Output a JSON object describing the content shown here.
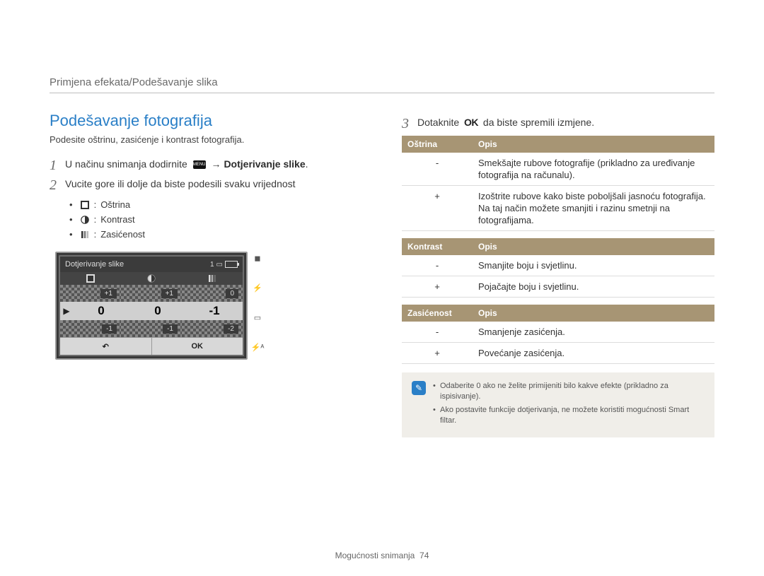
{
  "breadcrumb": "Primjena efekata/Podešavanje slika",
  "section_title": "Podešavanje fotografija",
  "intro": "Podesite oštrinu, zasićenje i kontrast fotografija.",
  "steps": {
    "s1_num": "1",
    "s1_a": "U načinu snimanja dodirnite ",
    "s1_menu": "MENU",
    "s1_b": " → ",
    "s1_c": "Dotjerivanje slike",
    "s1_d": ".",
    "s2_num": "2",
    "s2": "Vucite gore ili dolje da biste podesili svaku vrijednost",
    "s3_num": "3",
    "s3_a": "Dotaknite ",
    "s3_ok": "OK",
    "s3_b": " da biste spremili izmjene."
  },
  "bullets": {
    "b1": "Oštrina",
    "b2": "Kontrast",
    "b3": "Zasićenost"
  },
  "lcd": {
    "title": "Dotjerivanje slike",
    "count": "1",
    "row_top": {
      "c1": "+1",
      "c2": "+1",
      "c3": "0"
    },
    "row_mid": {
      "c1": "0",
      "c2": "0",
      "c3": "-1"
    },
    "row_bot": {
      "c1": "-1",
      "c2": "-1",
      "c3": "-2"
    },
    "back": "↶",
    "ok": "OK"
  },
  "table1": {
    "h1": "Oštrina",
    "h2": "Opis",
    "r1k": "-",
    "r1v": "Smekšajte rubove fotografije (prikladno za uređivanje fotografija na računalu).",
    "r2k": "+",
    "r2v": "Izoštrite rubove kako biste poboljšali jasnoću fotografija. Na taj način možete smanjiti i razinu smetnji na fotografijama."
  },
  "table2": {
    "h1": "Kontrast",
    "h2": "Opis",
    "r1k": "-",
    "r1v": "Smanjite boju i svjetlinu.",
    "r2k": "+",
    "r2v": "Pojačajte boju i svjetlinu."
  },
  "table3": {
    "h1": "Zasićenost",
    "h2": "Opis",
    "r1k": "-",
    "r1v": "Smanjenje zasićenja.",
    "r2k": "+",
    "r2v": "Povećanje zasićenja."
  },
  "note": {
    "n1": "Odaberite 0 ako ne želite primijeniti bilo kakve efekte (prikladno za ispisivanje).",
    "n2": "Ako postavite funkcije dotjerivanja, ne možete koristiti mogućnosti Smart filtar."
  },
  "footer": {
    "section": "Mogućnosti snimanja",
    "page": "74"
  }
}
